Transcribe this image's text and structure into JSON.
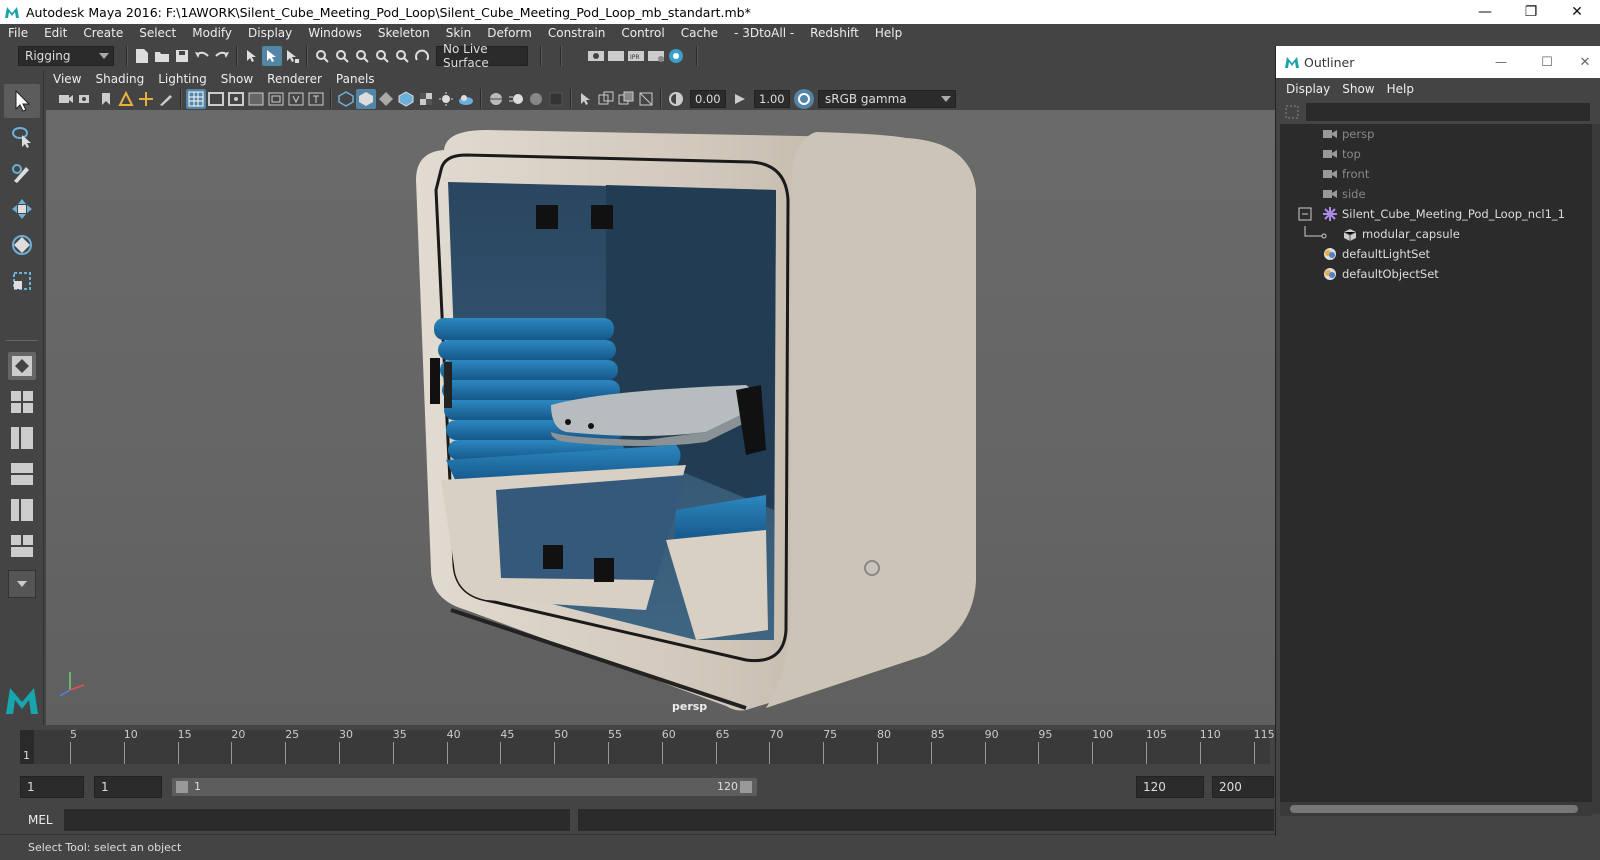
{
  "window": {
    "title": "Autodesk Maya 2016: F:\\1AWORK\\Silent_Cube_Meeting_Pod_Loop\\Silent_Cube_Meeting_Pod_Loop_mb_standart.mb*"
  },
  "menus": [
    "File",
    "Edit",
    "Create",
    "Select",
    "Modify",
    "Display",
    "Windows",
    "Skeleton",
    "Skin",
    "Deform",
    "Constrain",
    "Control",
    "Cache",
    "- 3DtoAll -",
    "Redshift",
    "Help"
  ],
  "statusline": {
    "menuset": "Rigging",
    "live_surface": "No Live Surface"
  },
  "panel_menus": [
    "View",
    "Shading",
    "Lighting",
    "Show",
    "Renderer",
    "Panels"
  ],
  "panel_toolbar": {
    "exposure": "0.00",
    "gamma": "1.00",
    "colorspace": "sRGB gamma"
  },
  "viewport": {
    "camera_label": "persp"
  },
  "timeline": {
    "ticks": [
      "5",
      "10",
      "15",
      "20",
      "25",
      "30",
      "35",
      "40",
      "45",
      "50",
      "55",
      "60",
      "65",
      "70",
      "75",
      "80",
      "85",
      "90",
      "95",
      "100",
      "105",
      "110",
      "115"
    ],
    "current_frame": "1"
  },
  "range": {
    "start": "1",
    "current": "1",
    "slider_start": "1",
    "slider_end": "120",
    "end": "120",
    "max": "200"
  },
  "cmd": {
    "lang": "MEL"
  },
  "help_line": "Select Tool: select an object",
  "outliner": {
    "title": "Outliner",
    "menus": [
      "Display",
      "Show",
      "Help"
    ],
    "items": [
      {
        "label": "persp",
        "icon": "camera-icon",
        "dim": true
      },
      {
        "label": "top",
        "icon": "camera-icon",
        "dim": true
      },
      {
        "label": "front",
        "icon": "camera-icon",
        "dim": true
      },
      {
        "label": "side",
        "icon": "camera-icon",
        "dim": true
      },
      {
        "label": "Silent_Cube_Meeting_Pod_Loop_ncl1_1",
        "icon": "group-icon",
        "dim": false
      },
      {
        "label": "modular_capsule",
        "icon": "mesh-icon",
        "dim": false
      },
      {
        "label": "defaultLightSet",
        "icon": "set-icon",
        "dim": false
      },
      {
        "label": "defaultObjectSet",
        "icon": "set-icon",
        "dim": false
      }
    ]
  }
}
